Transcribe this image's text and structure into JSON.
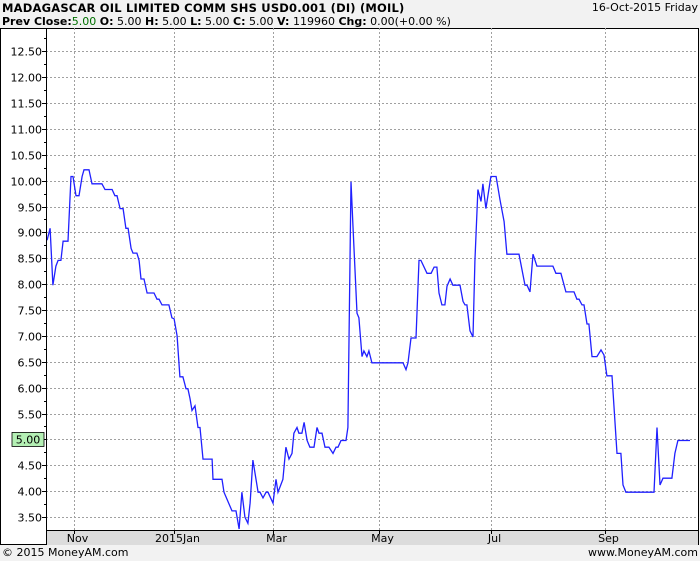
{
  "header": {
    "title": "MADAGASCAR OIL LIMITED COMM SHS USD0.001 (DI) (MOIL)",
    "date": "16-Oct-2015 Friday",
    "prev_close_label": "Prev Close:",
    "prev_close": "5.00",
    "open_label": "O:",
    "open": "5.00",
    "high_label": "H:",
    "high": "5.00",
    "low_label": "L:",
    "low": "5.00",
    "close_label": "C:",
    "close": "5.00",
    "volume_label": "V:",
    "volume": "119960",
    "change_label": "Chg:",
    "change": "0.00(+0.00 %)"
  },
  "footer": {
    "copyright": "© 2015 MoneyAM.com",
    "site": "www.MoneyAM.com"
  },
  "colors": {
    "line": "#2020ff",
    "badge": "#b4f0b4",
    "grid": "#a0a0a0",
    "axis_band": "#dcdcdc"
  },
  "chart_data": {
    "type": "line",
    "title": "MADAGASCAR OIL LIMITED COMM SHS USD0.001 (DI) (MOIL)",
    "xlabel": "",
    "ylabel": "",
    "xunit": "days since mid-Oct 2014 (approx.)",
    "xlim": [
      0,
      367.1
    ],
    "ylim": [
      3.25,
      12.95
    ],
    "grid": true,
    "current_value": "5.00",
    "x_ticks": [
      {
        "label": "Nov",
        "x": 15.8
      },
      {
        "label": "2015Jan",
        "x": 72.1
      },
      {
        "label": "Mar",
        "x": 127.8
      },
      {
        "label": "May",
        "x": 187.5
      },
      {
        "label": "Jul",
        "x": 250.5
      },
      {
        "label": "Sep",
        "x": 314.7
      }
    ],
    "y_ticks": [
      "3.50",
      "4.00",
      "4.50",
      "5.00",
      "5.50",
      "6.00",
      "6.50",
      "7.00",
      "7.50",
      "8.00",
      "8.50",
      "9.00",
      "9.50",
      "10.00",
      "10.50",
      "11.00",
      "11.50",
      "12.00",
      "12.50"
    ],
    "series": [
      {
        "name": "MOIL",
        "points": [
          [
            0.6,
            8.85
          ],
          [
            2.3,
            9.08
          ],
          [
            3.9,
            7.98
          ],
          [
            5.6,
            8.35
          ],
          [
            6.8,
            8.46
          ],
          [
            8.4,
            8.46
          ],
          [
            9.6,
            8.83
          ],
          [
            12.4,
            8.83
          ],
          [
            14.1,
            10.08
          ],
          [
            15.2,
            10.08
          ],
          [
            16.9,
            9.71
          ],
          [
            18.6,
            9.71
          ],
          [
            20.3,
            10.08
          ],
          [
            21.4,
            10.21
          ],
          [
            24.2,
            10.21
          ],
          [
            25.9,
            9.94
          ],
          [
            31.5,
            9.94
          ],
          [
            33.2,
            9.83
          ],
          [
            37.2,
            9.83
          ],
          [
            38.8,
            9.71
          ],
          [
            40,
            9.71
          ],
          [
            41.7,
            9.46
          ],
          [
            43.4,
            9.46
          ],
          [
            45,
            9.08
          ],
          [
            46.2,
            9.08
          ],
          [
            47.9,
            8.69
          ],
          [
            49,
            8.6
          ],
          [
            51.2,
            8.6
          ],
          [
            52.4,
            8.46
          ],
          [
            53.5,
            8.1
          ],
          [
            55.2,
            8.1
          ],
          [
            56.9,
            7.83
          ],
          [
            60.8,
            7.83
          ],
          [
            62.5,
            7.71
          ],
          [
            63.6,
            7.71
          ],
          [
            65.3,
            7.6
          ],
          [
            69.2,
            7.6
          ],
          [
            70.9,
            7.35
          ],
          [
            72.1,
            7.33
          ],
          [
            73.8,
            7.0
          ],
          [
            75.4,
            6.21
          ],
          [
            77.1,
            6.21
          ],
          [
            78.8,
            5.98
          ],
          [
            79.9,
            5.98
          ],
          [
            81.1,
            5.79
          ],
          [
            82.2,
            5.56
          ],
          [
            83.9,
            5.65
          ],
          [
            85.6,
            5.23
          ],
          [
            86.7,
            5.23
          ],
          [
            88.4,
            4.62
          ],
          [
            93.5,
            4.62
          ],
          [
            94,
            4.23
          ],
          [
            99.1,
            4.23
          ],
          [
            100.2,
            3.98
          ],
          [
            104.7,
            3.62
          ],
          [
            107,
            3.62
          ],
          [
            108.7,
            3.27
          ],
          [
            110.3,
            3.98
          ],
          [
            112,
            3.5
          ],
          [
            113.7,
            3.38
          ],
          [
            114.9,
            3.77
          ],
          [
            116.5,
            4.6
          ],
          [
            119.4,
            3.98
          ],
          [
            120.5,
            3.98
          ],
          [
            122.2,
            3.87
          ],
          [
            123.9,
            3.98
          ],
          [
            125,
            3.98
          ],
          [
            127.8,
            3.77
          ],
          [
            129.5,
            4.23
          ],
          [
            130.6,
            3.98
          ],
          [
            133.4,
            4.23
          ],
          [
            135.1,
            4.85
          ],
          [
            136.8,
            4.62
          ],
          [
            138.5,
            4.73
          ],
          [
            139.6,
            5.12
          ],
          [
            141.3,
            5.23
          ],
          [
            142.4,
            5.12
          ],
          [
            144.1,
            5.12
          ],
          [
            145.3,
            5.33
          ],
          [
            147,
            4.98
          ],
          [
            148.6,
            4.85
          ],
          [
            150.9,
            4.85
          ],
          [
            152.6,
            5.23
          ],
          [
            153.7,
            5.12
          ],
          [
            155.4,
            5.12
          ],
          [
            157.1,
            4.85
          ],
          [
            159.3,
            4.85
          ],
          [
            161.6,
            4.73
          ],
          [
            163.3,
            4.85
          ],
          [
            164.4,
            4.85
          ],
          [
            166.1,
            4.98
          ],
          [
            168.9,
            4.98
          ],
          [
            170,
            5.23
          ],
          [
            171.7,
            9.98
          ],
          [
            172.8,
            9.15
          ],
          [
            175.1,
            7.44
          ],
          [
            176.2,
            7.35
          ],
          [
            177.9,
            6.6
          ],
          [
            179,
            6.71
          ],
          [
            180.7,
            6.6
          ],
          [
            181.8,
            6.71
          ],
          [
            183.5,
            6.48
          ],
          [
            201,
            6.48
          ],
          [
            202.7,
            6.35
          ],
          [
            203.8,
            6.48
          ],
          [
            205.5,
            6.96
          ],
          [
            208.3,
            6.96
          ],
          [
            210,
            8.46
          ],
          [
            211.1,
            8.46
          ],
          [
            214.5,
            8.21
          ],
          [
            216.8,
            8.21
          ],
          [
            218.5,
            8.33
          ],
          [
            220.1,
            8.33
          ],
          [
            221.3,
            7.83
          ],
          [
            222.9,
            7.6
          ],
          [
            224.6,
            7.6
          ],
          [
            225.8,
            7.96
          ],
          [
            227.5,
            8.1
          ],
          [
            229.1,
            7.98
          ],
          [
            233.1,
            7.98
          ],
          [
            234.8,
            7.67
          ],
          [
            235.9,
            7.6
          ],
          [
            237,
            7.6
          ],
          [
            238.7,
            7.1
          ],
          [
            240.4,
            6.98
          ],
          [
            241.5,
            8.44
          ],
          [
            243.2,
            9.83
          ],
          [
            244.9,
            9.6
          ],
          [
            246,
            9.94
          ],
          [
            247.7,
            9.46
          ],
          [
            250.5,
            10.08
          ],
          [
            253.4,
            10.08
          ],
          [
            255.6,
            9.63
          ],
          [
            257.9,
            9.21
          ],
          [
            259.5,
            8.58
          ],
          [
            266.3,
            8.58
          ],
          [
            269.7,
            7.98
          ],
          [
            270.8,
            7.98
          ],
          [
            272.5,
            7.85
          ],
          [
            274.2,
            8.58
          ],
          [
            276.4,
            8.35
          ],
          [
            285.4,
            8.35
          ],
          [
            287.1,
            8.21
          ],
          [
            289.9,
            8.21
          ],
          [
            292.7,
            7.85
          ],
          [
            297.3,
            7.85
          ],
          [
            298.9,
            7.71
          ],
          [
            300.1,
            7.71
          ],
          [
            301.8,
            7.6
          ],
          [
            302.9,
            7.6
          ],
          [
            304.6,
            7.23
          ],
          [
            305.7,
            7.23
          ],
          [
            307.4,
            6.6
          ],
          [
            310.2,
            6.6
          ],
          [
            312.5,
            6.73
          ],
          [
            314.2,
            6.63
          ],
          [
            315.8,
            6.23
          ],
          [
            318.7,
            6.23
          ],
          [
            321.5,
            4.73
          ],
          [
            323.7,
            4.73
          ],
          [
            324.9,
            4.12
          ],
          [
            326.5,
            3.98
          ],
          [
            342.3,
            3.98
          ],
          [
            344,
            5.23
          ],
          [
            345.7,
            4.12
          ],
          [
            347.4,
            4.25
          ],
          [
            352.4,
            4.25
          ],
          [
            354.1,
            4.73
          ],
          [
            355.8,
            4.98
          ],
          [
            362.6,
            4.98
          ]
        ]
      }
    ]
  }
}
